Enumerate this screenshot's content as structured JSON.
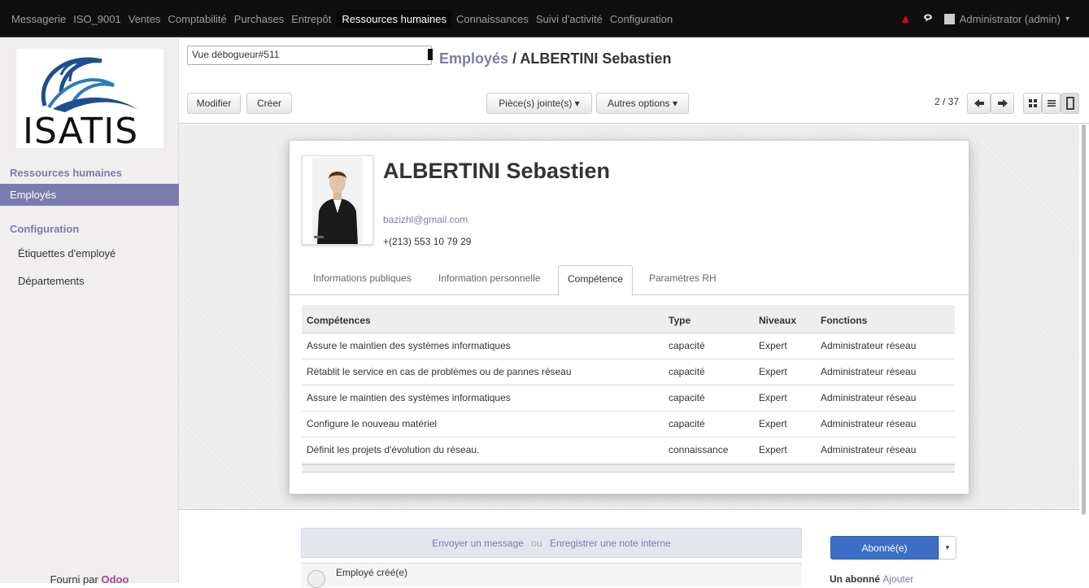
{
  "navbar": {
    "menu": [
      "Messagerie",
      "ISO_9001",
      "Ventes",
      "Comptabilité",
      "Purchases",
      "Entrepôt",
      "Ressources humaines",
      "Connaissances",
      "Suivi d'activité",
      "Configuration"
    ],
    "active_menu": "Ressources humaines",
    "user": "Administrator (admin)",
    "user_caret": "▾",
    "alert_icon": "▲",
    "chat_icon": "🗨"
  },
  "sidebar": {
    "logo_text": "ISATIS",
    "section1": "Ressources humaines",
    "items1": [
      "Employés"
    ],
    "section2": "Configuration",
    "items2": [
      "Étiquettes d'employé",
      "Départements"
    ],
    "footer_prefix": "Fourni par",
    "footer_brand": "Odoo"
  },
  "control": {
    "debug_select": "Vue débogueur#511",
    "breadcrumb_link": "Employés",
    "breadcrumb_sep": "/",
    "breadcrumb_current": "ALBERTINI Sebastien",
    "btn_edit": "Modifier",
    "btn_create": "Créer",
    "btn_attach": "Pièce(s) jointe(s) ▾",
    "btn_more": "Autres options ▾",
    "pager": "2 / 37"
  },
  "employee": {
    "name": "ALBERTINI Sebastien",
    "email": "bazizhl@gmail.com",
    "phone": "+(213) 553 10 79 29"
  },
  "tabs": [
    "Informations publiques",
    "Information personnelle",
    "Compétence",
    "Paramètres RH"
  ],
  "active_tab": "Compétence",
  "skills": {
    "headers": [
      "Compétences",
      "Type",
      "Niveaux",
      "Fonctions"
    ],
    "rows": [
      [
        "Assure le maintien des systèmes informatiques",
        "capacité",
        "Expert",
        "Administrateur réseau"
      ],
      [
        "Rétablit le service en cas de problèmes ou de pannes réseau",
        "capacité",
        "Expert",
        "Administrateur réseau"
      ],
      [
        "Assure le maintien des systèmes informatiques",
        "capacité",
        "Expert",
        "Administrateur réseau"
      ],
      [
        "Configure le nouveau matériel",
        "capacité",
        "Expert",
        "Administrateur réseau"
      ],
      [
        "Définit les projets d'évolution du réseau.",
        "connaissance",
        "Expert",
        "Administrateur réseau"
      ]
    ]
  },
  "chatter": {
    "send_message": "Envoyer un message",
    "ou": "ou",
    "log_note": "Enregistrer une note interne",
    "first_message": "Employé créé(e)",
    "follow_btn": "Abonné(e)",
    "follow_caret": "▾",
    "subscribers": "Un abonné",
    "add_link": "Ajouter"
  },
  "colors": {
    "brand": "#7c7bad",
    "navbar": "#0f0f0f",
    "primary": "#3b6ec7",
    "alert": "#e3001b"
  }
}
